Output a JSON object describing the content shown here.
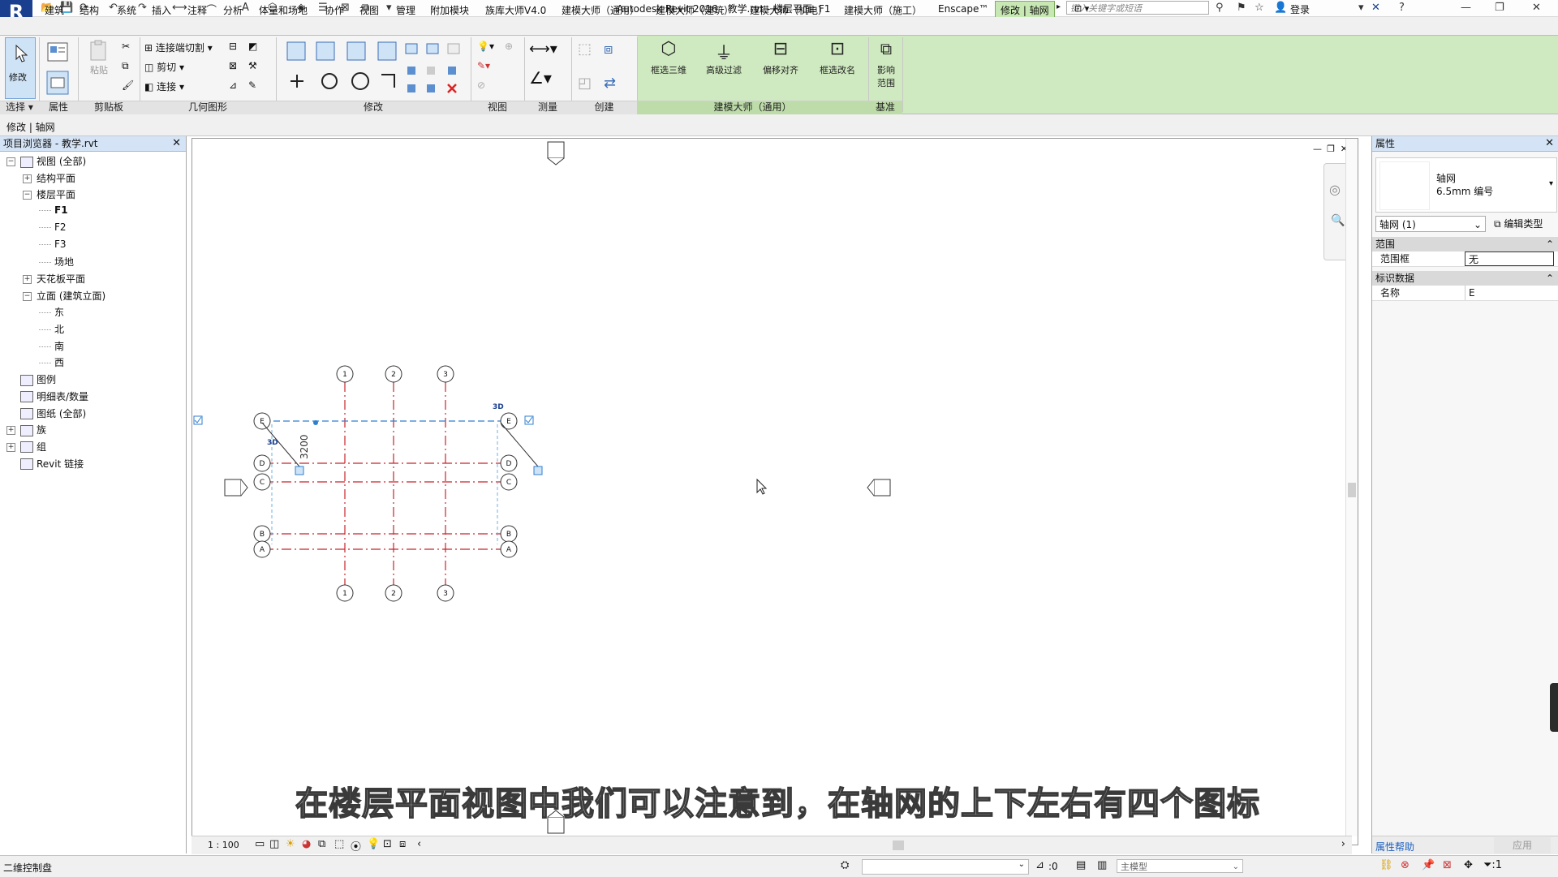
{
  "titlebar": {
    "title": "Autodesk Revit 2016 -    教学.rvt - 楼层平面: F1",
    "search_placeholder": "键入关键字或短语",
    "login": "登录"
  },
  "menu": {
    "tabs": [
      "建筑",
      "结构",
      "系统",
      "插入",
      "注释",
      "分析",
      "体量和场地",
      "协作",
      "视图",
      "管理",
      "附加模块",
      "族库大师V4.0",
      "建模大师（通用）",
      "建模大师（建筑）",
      "建模大师（机电）",
      "建模大师（施工）",
      "Enscape™"
    ],
    "active_tab": "修改 | 轴网"
  },
  "ribbon": {
    "modify_label": "修改",
    "paste_label": "粘贴",
    "geometry": {
      "join_cut": "连接端切割",
      "cut": "剪切",
      "join": "连接"
    },
    "panels": [
      "选择",
      "属性",
      "剪贴板",
      "几何图形",
      "修改",
      "视图",
      "测量",
      "创建",
      "建模大师（通用）",
      "基准"
    ],
    "jianmo_buttons": [
      "框选三维",
      "高级过滤",
      "偏移对齐",
      "框选改名"
    ],
    "datum_button": [
      "影响",
      "范围"
    ]
  },
  "optionsbar": {
    "text": "修改 | 轴网"
  },
  "browser": {
    "title": "项目浏览器 - 教学.rvt",
    "items": [
      {
        "label": "视图 (全部)",
        "level": 0,
        "toggle": "−"
      },
      {
        "label": "结构平面",
        "level": 1,
        "toggle": "+"
      },
      {
        "label": "楼层平面",
        "level": 1,
        "toggle": "−"
      },
      {
        "label": "F1",
        "level": 2,
        "toggle": ""
      },
      {
        "label": "F2",
        "level": 2,
        "toggle": ""
      },
      {
        "label": "F3",
        "level": 2,
        "toggle": ""
      },
      {
        "label": "场地",
        "level": 2,
        "toggle": ""
      },
      {
        "label": "天花板平面",
        "level": 1,
        "toggle": "+"
      },
      {
        "label": "立面 (建筑立面)",
        "level": 1,
        "toggle": "−"
      },
      {
        "label": "东",
        "level": 2,
        "toggle": ""
      },
      {
        "label": "北",
        "level": 2,
        "toggle": ""
      },
      {
        "label": "南",
        "level": 2,
        "toggle": ""
      },
      {
        "label": "西",
        "level": 2,
        "toggle": ""
      },
      {
        "label": "图例",
        "level": 0,
        "toggle": ""
      },
      {
        "label": "明细表/数量",
        "level": 0,
        "toggle": ""
      },
      {
        "label": "图纸 (全部)",
        "level": 0,
        "toggle": ""
      },
      {
        "label": "族",
        "level": 0,
        "toggle": "+"
      },
      {
        "label": "组",
        "level": 0,
        "toggle": "+"
      },
      {
        "label": "Revit 链接",
        "level": 0,
        "toggle": ""
      }
    ]
  },
  "drawing": {
    "top_bubbles": [
      "1",
      "2",
      "3"
    ],
    "bottom_bubbles": [
      "1",
      "2",
      "3"
    ],
    "left_bubbles": [
      "E",
      "D",
      "C",
      "B",
      "A"
    ],
    "right_bubbles": [
      "E",
      "D",
      "C",
      "B",
      "A"
    ],
    "dimension": "3200",
    "label_3d": "3D"
  },
  "viewcontrol": {
    "scale": "1 : 100"
  },
  "properties": {
    "title": "属性",
    "type_name": "轴网",
    "type_sub": "6.5mm 编号",
    "instance": "轴网 (1)",
    "edit_type": "编辑类型",
    "sections": [
      {
        "name": "范围",
        "rows": [
          {
            "k": "范围框",
            "v": "无"
          }
        ]
      },
      {
        "name": "标识数据",
        "rows": [
          {
            "k": "名称",
            "v": "E"
          }
        ]
      }
    ],
    "help": "属性帮助",
    "apply": "应用"
  },
  "status": {
    "text": "二维控制盘",
    "zero": ":0",
    "model": "主模型"
  },
  "subtitle": "在楼层平面视图中我们可以注意到，在轴网的上下左右有四个图标",
  "colors": {
    "ribbon_green": "#cfe9c0",
    "grid_red": "#c8242b",
    "grid_blue": "#2f7fd0"
  }
}
